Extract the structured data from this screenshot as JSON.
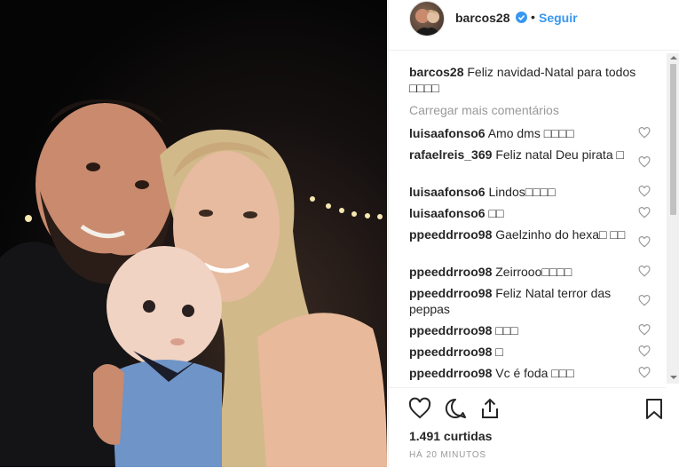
{
  "header": {
    "username": "barcos28",
    "separator": "•",
    "follow_label": "Seguir"
  },
  "caption": {
    "username": "barcos28",
    "text": "Feliz navidad-Natal para todos",
    "emoji": "□□□□"
  },
  "load_more": "Carregar mais comentários",
  "comments": [
    {
      "user": "luisaafonso6",
      "text": "Amo dms □□□□"
    },
    {
      "user": "rafaelreis_369",
      "text": "Feliz natal Deu pirata □"
    },
    {
      "user": "luisaafonso6",
      "text": "Lindos□□□□"
    },
    {
      "user": "luisaafonso6",
      "text": "□□"
    },
    {
      "user": "ppeeddrroo98",
      "text": "Gaelzinho do hexa□ □□"
    },
    {
      "user": "ppeeddrroo98",
      "text": "Zeirrooo□□□□"
    },
    {
      "user": "ppeeddrroo98",
      "text": "Feliz Natal terror das peppas"
    },
    {
      "user": "ppeeddrroo98",
      "text": "□□□"
    },
    {
      "user": "ppeeddrroo98",
      "text": "□"
    },
    {
      "user": "ppeeddrroo98",
      "text": "Vc é foda □□□"
    }
  ],
  "likes": "1.491 curtidas",
  "timestamp": "HÁ 20 MINUTOS",
  "icons": {
    "like": "heart-outline-icon",
    "comment": "speech-bubble-icon",
    "share": "share-upload-icon",
    "save": "bookmark-icon",
    "verified": "verified-badge-icon"
  },
  "colors": {
    "link_blue": "#3897f0",
    "verified_blue": "#3897f0",
    "muted_text": "#999999",
    "text": "#262626"
  }
}
